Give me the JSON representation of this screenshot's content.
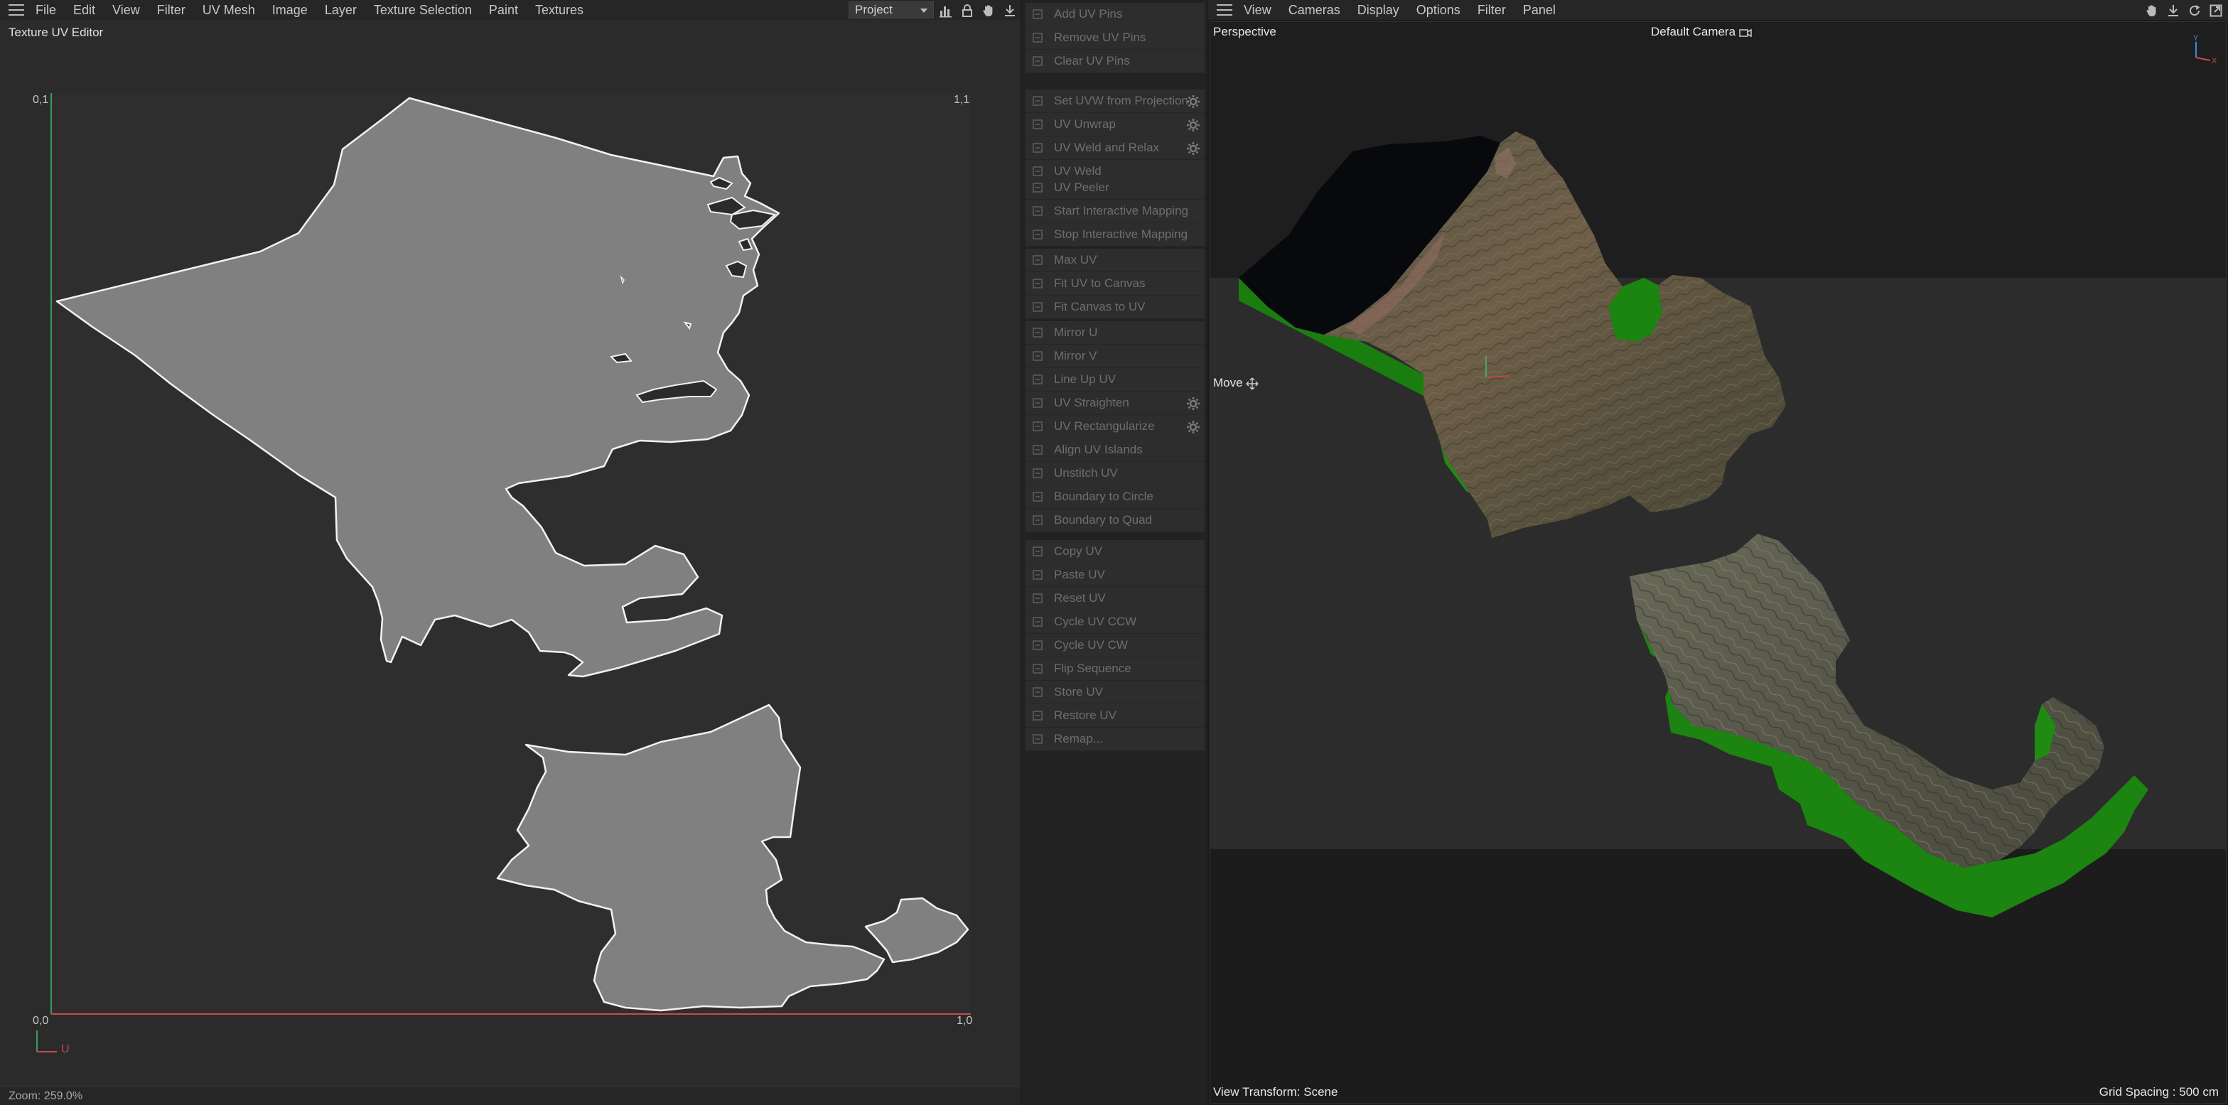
{
  "uv_editor": {
    "menu": [
      "File",
      "Edit",
      "View",
      "Filter",
      "UV Mesh",
      "Image",
      "Layer",
      "Texture Selection",
      "Paint",
      "Textures"
    ],
    "project_select": "Project",
    "title": "Texture UV Editor",
    "corner_labels": {
      "top_left": "0,1",
      "top_right": "1,1",
      "bottom_left": "0,0",
      "bottom_right": "1,0"
    },
    "axis_u_label": "U",
    "status": "Zoom: 259.0%",
    "toolbar_icons": [
      "histogram-icon",
      "lock-icon",
      "hand-icon",
      "pin-icon"
    ]
  },
  "uv_commands": {
    "groups": [
      [
        {
          "label": "Add UV Pins",
          "icon": "pin-add-icon"
        },
        {
          "label": "Remove UV Pins",
          "icon": "pin-remove-icon"
        },
        {
          "label": "Clear UV Pins",
          "icon": "clear-icon"
        }
      ],
      [
        {
          "label": "Set UVW from Projection",
          "icon": "projection-icon",
          "gear": true
        },
        {
          "label": "UV Unwrap",
          "icon": "unwrap-icon",
          "gear": true
        },
        {
          "label": "UV Weld and Relax",
          "icon": "relax-icon",
          "gear": true
        },
        {
          "label": "UV Weld",
          "icon": "weld-icon"
        }
      ],
      [
        {
          "label": "UV Peeler",
          "icon": "peeler-icon"
        },
        {
          "label": "Start Interactive Mapping",
          "icon": "play-icon"
        },
        {
          "label": "Stop Interactive Mapping",
          "icon": "stop-icon"
        }
      ],
      [
        {
          "label": "Max UV",
          "icon": "max-icon"
        },
        {
          "label": "Fit UV to Canvas",
          "icon": "fit-icon"
        },
        {
          "label": "Fit Canvas to UV",
          "icon": "fit-canvas-icon"
        }
      ],
      [
        {
          "label": "Mirror U",
          "icon": "mirror-u-icon"
        },
        {
          "label": "Mirror V",
          "icon": "mirror-v-icon"
        },
        {
          "label": "Line Up UV",
          "icon": "line-up-icon"
        },
        {
          "label": "UV Straighten",
          "icon": "straighten-icon",
          "gear": true
        },
        {
          "label": "UV Rectangularize",
          "icon": "rectangularize-icon",
          "gear": true
        },
        {
          "label": "Align UV Islands",
          "icon": "align-icon"
        },
        {
          "label": "Unstitch UV",
          "icon": "unstitch-icon"
        },
        {
          "label": "Boundary to Circle",
          "icon": "circle-icon"
        },
        {
          "label": "Boundary to Quad",
          "icon": "quad-icon"
        }
      ],
      [
        {
          "label": "Copy UV",
          "icon": "copy-icon"
        },
        {
          "label": "Paste UV",
          "icon": "paste-icon"
        },
        {
          "label": "Reset UV",
          "icon": "reset-icon"
        },
        {
          "label": "Cycle UV CCW",
          "icon": "cycle-ccw-icon"
        },
        {
          "label": "Cycle UV CW",
          "icon": "cycle-cw-icon"
        },
        {
          "label": "Flip Sequence",
          "icon": "flip-icon"
        },
        {
          "label": "Store UV",
          "icon": "store-icon"
        },
        {
          "label": "Restore UV",
          "icon": "restore-icon"
        },
        {
          "label": "Remap...",
          "icon": "remap-icon"
        }
      ]
    ]
  },
  "viewport": {
    "menu": [
      "View",
      "Cameras",
      "Display",
      "Options",
      "Filter",
      "Panel"
    ],
    "projection_label": "Perspective",
    "camera_label": "Default Camera",
    "tool_label": "Move",
    "view_transform": "View Transform: Scene",
    "grid_spacing": "Grid Spacing : 500 cm",
    "axis_labels": {
      "y": "Y",
      "x": "X"
    },
    "toolbar_icons": [
      "hand-icon",
      "move-icon",
      "rotate-icon",
      "maximize-icon"
    ]
  },
  "colors": {
    "panel_bg": "#2b2b2b",
    "island_fill": "#808080",
    "island_edge": "#f2f2f2",
    "v_axis": "#3c9a5a",
    "u_axis": "#c84a4a",
    "extrusion_green": "#1e8a12"
  }
}
